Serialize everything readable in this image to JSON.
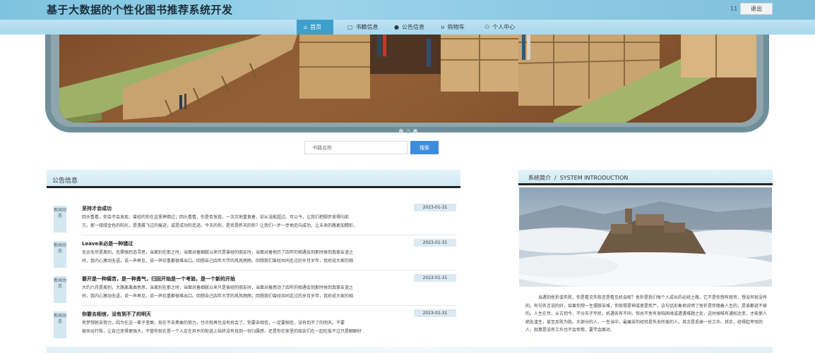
{
  "header": {
    "title": "基于大数据的个性化图书推荐系统开发",
    "user_mark": "11",
    "logout_label": "退出"
  },
  "nav": [
    {
      "label": "首页",
      "icon": "home-icon",
      "active": true
    },
    {
      "label": "书籍信息",
      "icon": "book-icon",
      "active": false
    },
    {
      "label": "公告信息",
      "icon": "notice-icon",
      "active": false
    },
    {
      "label": "购物车",
      "icon": "cart-icon",
      "active": false
    },
    {
      "label": "个人中心",
      "icon": "user-icon",
      "active": false
    }
  ],
  "carousel": {
    "dots": 3,
    "active_index": 1
  },
  "search": {
    "placeholder": "书籍名称",
    "button_label": "搜索"
  },
  "notices": {
    "title": "公告信息",
    "tag": "新闻动态",
    "items": [
      {
        "title": "坚持才会成功",
        "date": "2023-01-31",
        "line1": "回头看看，你会不会发现，曾经的你在这里摔倒过；回头看看，你是否发现，一次次地重复着，却从没能超过。可以今，让我们把脚步放得向前",
        "line2": "方，那一缕缕金色的阳光，是清晨飞过的痕迹，或是成功的足迹。今天的你，是否是昨天的你？让我们一步一步地走向成功，让未来的路更加精彩。"
      },
      {
        "title": "Leave未必是一种错过",
        "date": "2023-01-31",
        "line1": "无论无尽是离别，无需强烈追寻思，当离别在那之时，当面对着细腻以来只是曾经的朋友时，当面对着他历了四年的相遇会到那时候到真挚友谊之",
        "line2": "时，我内心激动无语，说一声再见，说一声珍重都很难出口。回想自己四年大学的风风雨雨，回想我们曾经共同走过的岁月岁年，我劝说大家的相"
      },
      {
        "title": "要开是一种痛苦，是一种勇气，归回开始是一个考验，是一个新的开始",
        "date": "2023-01-31",
        "line1": "大约六月是离别，大路离离曲思思，当离别在那之时，当面对着细腻以来只是曾经的朋友时，当面对着感动了四年的相遇会到那时候到真挚友谊之",
        "line2": "时，我内心激动无语，说一声再见，说一声珍重都很难出口。回想自己四年大学的风风雨雨，回想我们曾经共同走过的岁月岁年，我劝说大家的相"
      },
      {
        "title": "你要去相信，没有到不了的明天",
        "date": "2023-01-31",
        "line1": "有梦想就去努力，因为在这一辈子里面，现在不去勇敢的努力，也许就再也没有机会了。你要去相信，一定要相信，没有到不了的明天。不要",
        "line2": "被命运打败，让自己变得更强大，不管你现在是一个人走在异乡的街道上始终没有找到一份归属感，还是你在家里的朋友们在一起吃饭不过只是聊聊好"
      }
    ]
  },
  "intro": {
    "title": "系统简介",
    "subtitle": "SYSTEM INTRODUCTION",
    "text": "当遇到挫折或失败，你是看见失败还是看见机会呢？挫折是我们每个人成长的必经之路，它不是你想有就有，想没有就没有的。有句名言说的好，如果你想一生摆脱苦难，你就得是神或者是死尸。这句话形象地说明了挫折是伴随着人生的，是谁都逃不掉的。人生在世，从古到今，不分天子平民，机遇各有不同，但总不免有身陷困境或遭遇难题之处，这时候唯有通权达变，才能使人绝处逢生，甚至反败为胜。大部分的人，一生当中，最痛苦的经验是失去所爱的人，其次是丢掉一份工作。其实，经得起考验的人，就算是没有工作也不会惊慌，要学会面对。"
  }
}
